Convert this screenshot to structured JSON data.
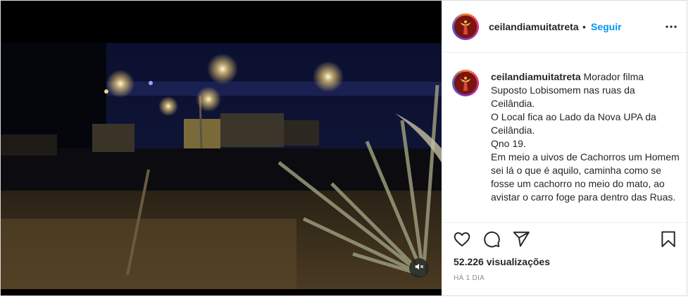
{
  "post": {
    "author": {
      "username": "ceilandiamuitatreta"
    },
    "header": {
      "separator": "•",
      "follow_label": "Seguir",
      "more_icon": "more-options-icon"
    },
    "caption": {
      "username": "ceilandiamuitatreta",
      "text": "Morador filma Suposto Lobisomem nas ruas da Ceilândia.\nO Local fica ao Lado da Nova UPA da Ceilândia.\nQno 19.\nEm meio a uivos de Cachorros um Homem sei lá o que é aquilo, caminha como se fosse um cachorro no meio do mato, ao avistar o carro foge para dentro das Ruas."
    },
    "actions": {
      "like_icon": "heart-icon",
      "comment_icon": "comment-icon",
      "share_icon": "share-icon",
      "save_icon": "bookmark-icon"
    },
    "views_label": "52.226 visualizações",
    "time_label": "HÁ 1 DIA",
    "video": {
      "mute_icon": "muted-speaker-icon"
    }
  },
  "colors": {
    "link": "#0095f6",
    "text": "#262626",
    "muted": "#8e8e8e",
    "border": "#dbdbdb"
  }
}
